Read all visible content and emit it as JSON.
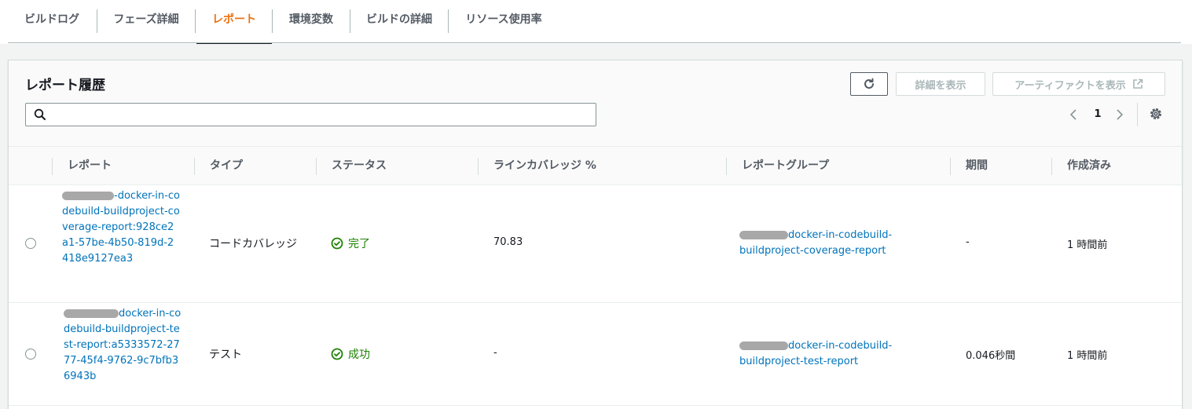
{
  "tabs": [
    {
      "label": "ビルドログ"
    },
    {
      "label": "フェーズ詳細"
    },
    {
      "label": "レポート"
    },
    {
      "label": "環境変数"
    },
    {
      "label": "ビルドの詳細"
    },
    {
      "label": "リソース使用率"
    }
  ],
  "active_tab": "レポート",
  "panel": {
    "title": "レポート履歴",
    "buttons": {
      "refresh_icon": "refresh-icon",
      "details": "詳細を表示",
      "artifacts": "アーティファクトを表示"
    },
    "search": {
      "placeholder": "",
      "value": ""
    },
    "pagination": {
      "current_page": "1"
    }
  },
  "table": {
    "columns": [
      "レポート",
      "タイプ",
      "ステータス",
      "ラインカバレッジ %",
      "レポートグループ",
      "期間",
      "作成済み"
    ],
    "rows": [
      {
        "report_suffix": "-docker-in-codebuild-buildproject-coverage-report:928ce2a1-57be-4b50-819d-2418e9127ea3",
        "type": "コードカバレッジ",
        "status": "完了",
        "line_coverage": "70.83",
        "report_group": "docker-in-codebuild-buildproject-coverage-report",
        "duration": "-",
        "created": "1 時間前"
      },
      {
        "report_suffix": "docker-in-codebuild-buildproject-test-report:a5333572-2777-45f4-9762-9c7bfb36943b",
        "type": "テスト",
        "status": "成功",
        "line_coverage": "-",
        "report_group": "docker-in-codebuild-buildproject-test-report",
        "duration": "0.046秒間",
        "created": "1 時間前"
      }
    ]
  },
  "colors": {
    "active_tab": "#ec7211",
    "link": "#0073bb",
    "success": "#1d8102",
    "disabled": "#aab7b8"
  }
}
